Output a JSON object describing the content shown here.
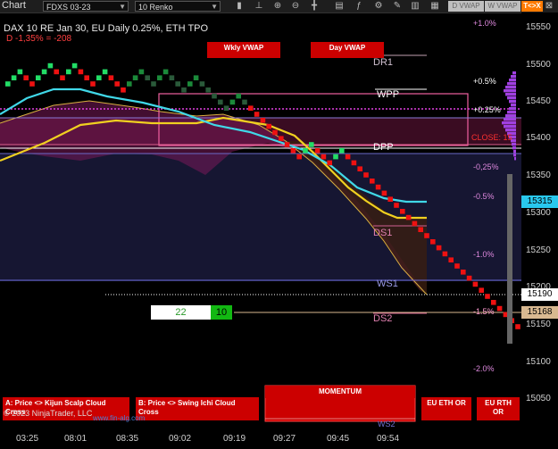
{
  "toolbar": {
    "title": "Chart",
    "instrument": "FDXS 03-23",
    "bar_type": "10 Renko",
    "d_vwap": "D VWAP",
    "w_vwap": "W VWAP",
    "t_cross": "T<>X"
  },
  "header": {
    "line1": "DAX 10  RE Jan 30, EU Daily 0.25%, ETH TPO",
    "line2": "D -1,35% = -208"
  },
  "vwap_buttons": {
    "weekly": "Wkly VWAP",
    "daily": "Day VWAP"
  },
  "levels": {
    "dr1": "DR1",
    "wpp": "WPP",
    "dpp": "DPP",
    "ds1": "DS1",
    "ws1": "WS1",
    "ds2": "DS2",
    "close": "CLOSE: 15",
    "ws2": "WS2"
  },
  "percent_labels": [
    "+1.0%",
    "+0.5%",
    "+0.25%",
    "-0,25%",
    "-0.5%",
    "-1.0%",
    "-1.5%",
    "-2.0%"
  ],
  "price_axis": {
    "ticks": [
      "15550",
      "15500",
      "15450",
      "15400",
      "15350",
      "15300",
      "15250",
      "15200",
      "15150",
      "15100",
      "15050"
    ],
    "tags": {
      "cyan": "15315",
      "white": "15190",
      "tan": "15168"
    },
    "colors": {
      "cyan": "#29c8ee",
      "white": "#ffffff",
      "tan": "#d9b991"
    }
  },
  "time_axis": [
    "03:25",
    "08:01",
    "08:35",
    "09:02",
    "09:19",
    "09:27",
    "09:45",
    "09:54"
  ],
  "counter": {
    "value_a": "22",
    "value_b": "10"
  },
  "bottom_buttons": {
    "a": "A: Price <> Kijun Scalp Cloud Cross",
    "b": "B: Price <> Swing Ichi Cloud Cross",
    "momentum": "MOMENTUM",
    "eu_eth": "EU ETH OR",
    "eu_rth": "EU RTH OR"
  },
  "footer": {
    "copyright": "© 2023 NinjaTrader, LLC",
    "site": "www.fin-alg.com"
  },
  "colors": {
    "up_brick": "#22dd66",
    "down_brick": "#ee1111",
    "accent_red": "#cc0000",
    "purple": "#a040e0"
  }
}
